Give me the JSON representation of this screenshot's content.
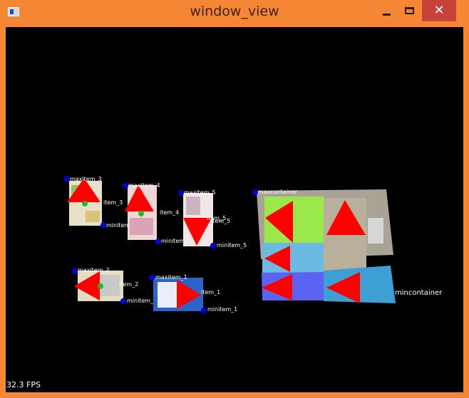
{
  "window": {
    "title": "window_view",
    "close_glyph": "✕",
    "icons": [
      "app-window-icon",
      "minimize-icon",
      "maximize-icon",
      "close-icon"
    ]
  },
  "labels": {
    "maxitem_1": "maxitem_1",
    "minitem_1": "minitem_1",
    "maxitem_2": "maxitem_2",
    "minitem_2": "minitem_2",
    "maxitem_3": "maxitem_3",
    "minitem_3": "minitem_3",
    "maxitem_4": "maxitem_4",
    "minitem_4": "minitem_4",
    "maxitem_5": "maxitem_5",
    "minitem_5": "minitem_5",
    "maxcontainer": "maxcontainer",
    "mincontainer": "mincontainer",
    "overlap_3": "item_3",
    "overlap_4": "item_4",
    "overlap_5a": "item_5",
    "overlap_5b": "item_5",
    "overlap_2": "item_2",
    "overlap_1": "item_1"
  },
  "status": {
    "fps": "32.3 FPS"
  },
  "colors": {
    "frame": "#f58634",
    "close_button": "#c7433a",
    "background": "#000000",
    "marker_arrow": "#ff0000",
    "corner_point": "#0000dd",
    "center_point": "#22bb22",
    "container_green": "#9be84b",
    "container_tan": "#b8b09a",
    "container_lightblue": "#6cb9e2",
    "container_blue": "#5b63f0",
    "container_steel": "#3d9fd4"
  }
}
